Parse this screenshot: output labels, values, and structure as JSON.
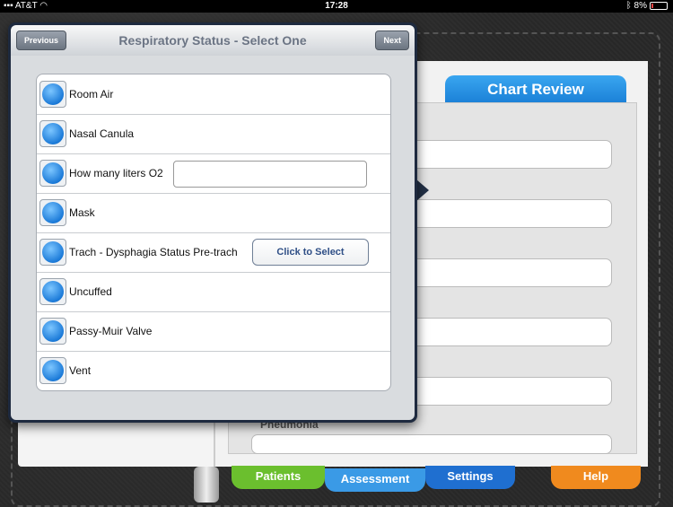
{
  "status_bar": {
    "carrier": "AT&T",
    "time": "17:28",
    "battery": "8%"
  },
  "chart_review": {
    "tab_label": "Chart Review",
    "partial_label": "Pneumonia"
  },
  "bottom_tabs": [
    {
      "label": "Patients",
      "color": "#6bbf2e"
    },
    {
      "label": "Assessment",
      "color": "#2a8de0"
    },
    {
      "label": "Settings",
      "color": "#1f6fd0"
    },
    {
      "label": "Help",
      "color": "#f08a1e"
    }
  ],
  "popover": {
    "title": "Respiratory Status - Select One",
    "previous_label": "Previous",
    "next_label": "Next",
    "options": [
      {
        "label": "Room Air"
      },
      {
        "label": "Nasal Canula"
      },
      {
        "label": "How many liters O2",
        "input_value": ""
      },
      {
        "label": "Mask"
      },
      {
        "label": "Trach - Dysphagia Status Pre-trach",
        "button_label": "Click to Select"
      },
      {
        "label": "Uncuffed"
      },
      {
        "label": "Passy-Muir Valve"
      },
      {
        "label": "Vent"
      }
    ]
  }
}
